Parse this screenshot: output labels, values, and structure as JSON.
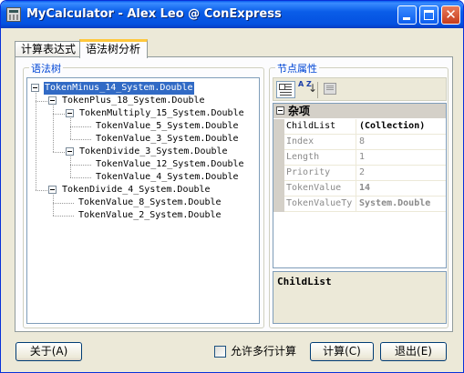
{
  "window": {
    "title": "MyCalculator - Alex Leo @ ConExpress",
    "close_glyph": "✕"
  },
  "tabs": [
    {
      "label": "计算表达式",
      "selected": false
    },
    {
      "label": "语法树分析",
      "selected": true
    }
  ],
  "tree_panel": {
    "group_label": "语法树",
    "nodes": [
      {
        "label": "TokenMinus_14_System.Double",
        "level": 0,
        "expandable": true,
        "selected": true
      },
      {
        "label": "TokenPlus_18_System.Double",
        "level": 1,
        "expandable": true
      },
      {
        "label": "TokenMultiply_15_System.Double",
        "level": 2,
        "expandable": true
      },
      {
        "label": "TokenValue_5_System.Double",
        "level": 3,
        "expandable": false
      },
      {
        "label": "TokenValue_3_System.Double",
        "level": 3,
        "expandable": false
      },
      {
        "label": "TokenDivide_3_System.Double",
        "level": 2,
        "expandable": true
      },
      {
        "label": "TokenValue_12_System.Double",
        "level": 3,
        "expandable": false
      },
      {
        "label": "TokenValue_4_System.Double",
        "level": 3,
        "expandable": false
      },
      {
        "label": "TokenDivide_4_System.Double",
        "level": 1,
        "expandable": true
      },
      {
        "label": "TokenValue_8_System.Double",
        "level": 2,
        "expandable": false
      },
      {
        "label": "TokenValue_2_System.Double",
        "level": 2,
        "expandable": false
      }
    ]
  },
  "property_panel": {
    "group_label": "节点属性",
    "toolbar": {
      "categorized_icon": "categorized-icon",
      "alphabetical_icon": "sort-az-icon",
      "alphabetical_text": "A Z",
      "alphabetical_arrow": "↓",
      "property_pages_icon": "property-pages-icon"
    },
    "category": "杂项",
    "properties": [
      {
        "name": "ChildList",
        "value": "(Collection)",
        "active": true
      },
      {
        "name": "Index",
        "value": "8"
      },
      {
        "name": "Length",
        "value": "1"
      },
      {
        "name": "Priority",
        "value": "2"
      },
      {
        "name": "TokenValue",
        "value": "14",
        "bold": true
      },
      {
        "name": "TokenValueType",
        "value": "System.Double",
        "bold": true
      }
    ],
    "description_title": "ChildList"
  },
  "footer": {
    "about_label": "关于(A)",
    "multiline_label": "允许多行计算",
    "multiline_checked": false,
    "calc_label": "计算(C)",
    "exit_label": "退出(E)"
  }
}
